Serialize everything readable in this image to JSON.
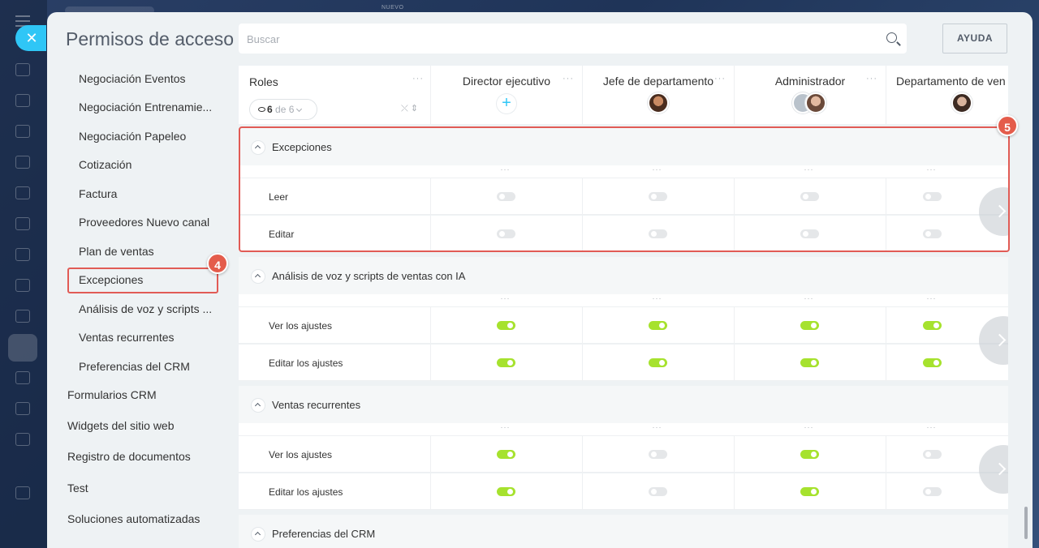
{
  "window": {
    "title": "Permisos de acceso",
    "top_tag": "NUEVO",
    "close_icon": "close-icon"
  },
  "search": {
    "placeholder": "Buscar"
  },
  "help_button": "AYUDA",
  "sidebar": {
    "sub_items": [
      "Negociación Eventos",
      "Negociación Entrenamie...",
      "Negociación Papeleo",
      "Cotización",
      "Factura",
      "Proveedores Nuevo canal",
      "Plan de ventas",
      "Excepciones",
      "Análisis de voz y scripts ...",
      "Ventas recurrentes",
      "Preferencias del CRM"
    ],
    "top_items": [
      "Formularios CRM",
      "Widgets del sitio web",
      "Registro de documentos",
      "Test",
      "Soluciones automatizadas"
    ],
    "selected": "Excepciones"
  },
  "badges": {
    "sidebar": "4",
    "section": "5"
  },
  "table": {
    "roles_label": "Roles",
    "more": "···",
    "role_filter": {
      "shown": "6",
      "total": "de 6"
    },
    "columns": [
      "Director ejecutivo",
      "Jefe de departamento",
      "Administrador",
      "Departamento de ven"
    ],
    "sections": [
      {
        "title": "Excepciones",
        "rows": [
          {
            "label": "Leer",
            "states": [
              false,
              false,
              false,
              false
            ]
          },
          {
            "label": "Editar",
            "states": [
              false,
              false,
              false,
              false
            ]
          }
        ]
      },
      {
        "title": "Análisis de voz y scripts de ventas con IA",
        "rows": [
          {
            "label": "Ver los ajustes",
            "states": [
              true,
              true,
              true,
              true
            ]
          },
          {
            "label": "Editar los ajustes",
            "states": [
              true,
              true,
              true,
              true
            ]
          }
        ]
      },
      {
        "title": "Ventas recurrentes",
        "rows": [
          {
            "label": "Ver los ajustes",
            "states": [
              true,
              false,
              true,
              false
            ]
          },
          {
            "label": "Editar los ajustes",
            "states": [
              true,
              false,
              true,
              false
            ]
          }
        ]
      },
      {
        "title": "Preferencias del CRM",
        "rows": []
      }
    ]
  },
  "colors": {
    "accent": "#2fc6f6",
    "toggle_on": "#a6e22e",
    "toggle_off": "#e5e7e9",
    "highlight": "#e15b55"
  }
}
